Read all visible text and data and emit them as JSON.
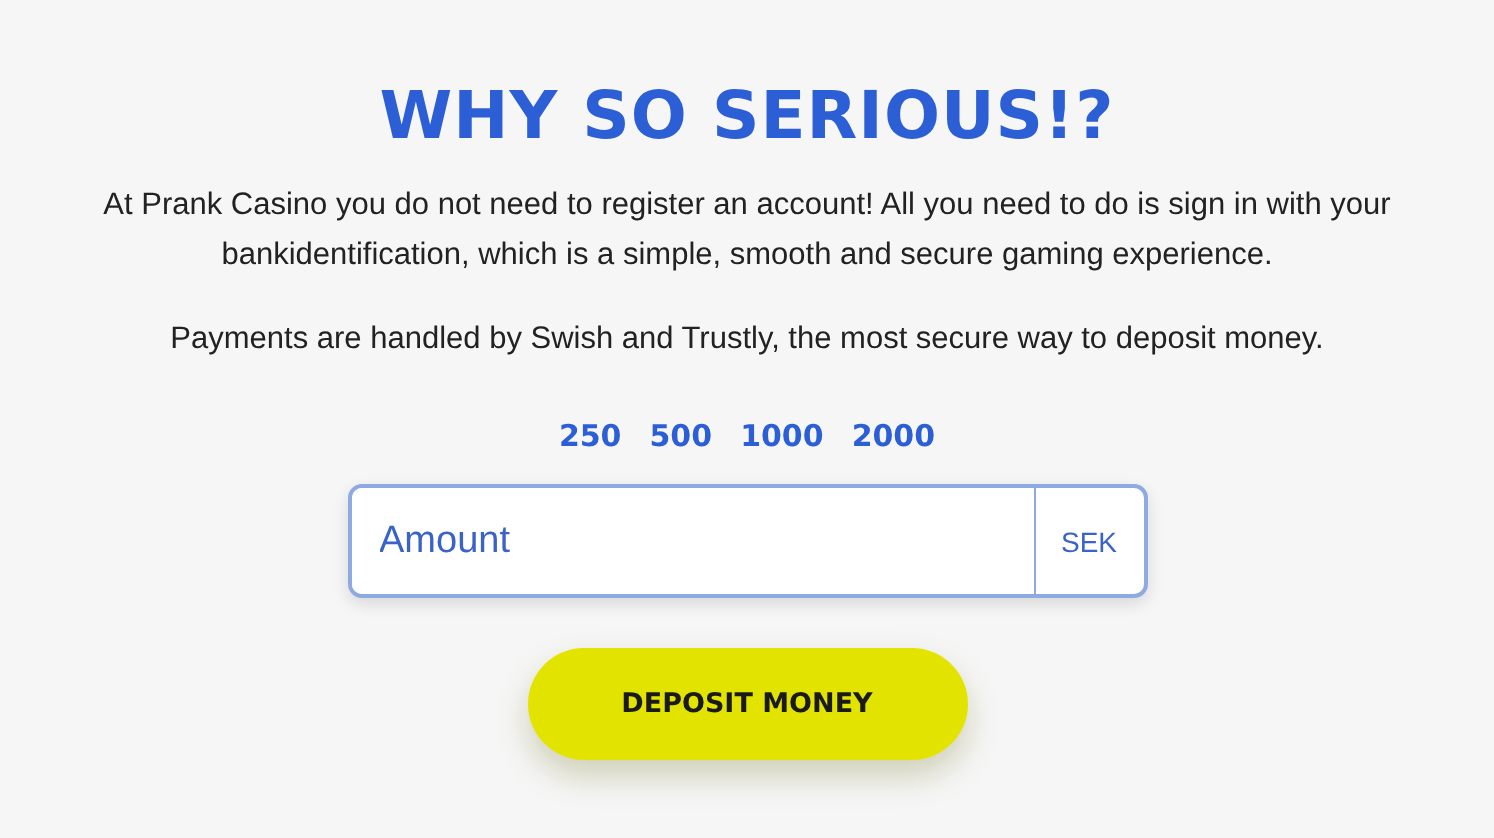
{
  "title": "WHY SO SERIOUS!?",
  "paragraphs": [
    "At Prank Casino you do not need to register an account! All you need to do is sign in with your bankidentification, which is a simple, smooth and secure gaming experience.",
    "Payments are handled by Swish and Trustly, the most secure way to deposit money."
  ],
  "quick_amounts": [
    "250",
    "500",
    "1000",
    "2000"
  ],
  "amount_field": {
    "placeholder": "Amount",
    "currency": "SEK"
  },
  "deposit_button": "DEPOSIT MONEY"
}
